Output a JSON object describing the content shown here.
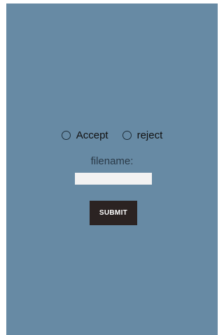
{
  "colors": {
    "background": "#678aa4",
    "button": "#2b2322",
    "button_text": "#ffffff",
    "input": "#f2f2f2"
  },
  "choices": [
    {
      "label": "Accept",
      "checked": false
    },
    {
      "label": "reject",
      "checked": false
    }
  ],
  "form": {
    "filename_label": "filename:",
    "filename_value": "",
    "submit_label": "SUBMIT"
  }
}
